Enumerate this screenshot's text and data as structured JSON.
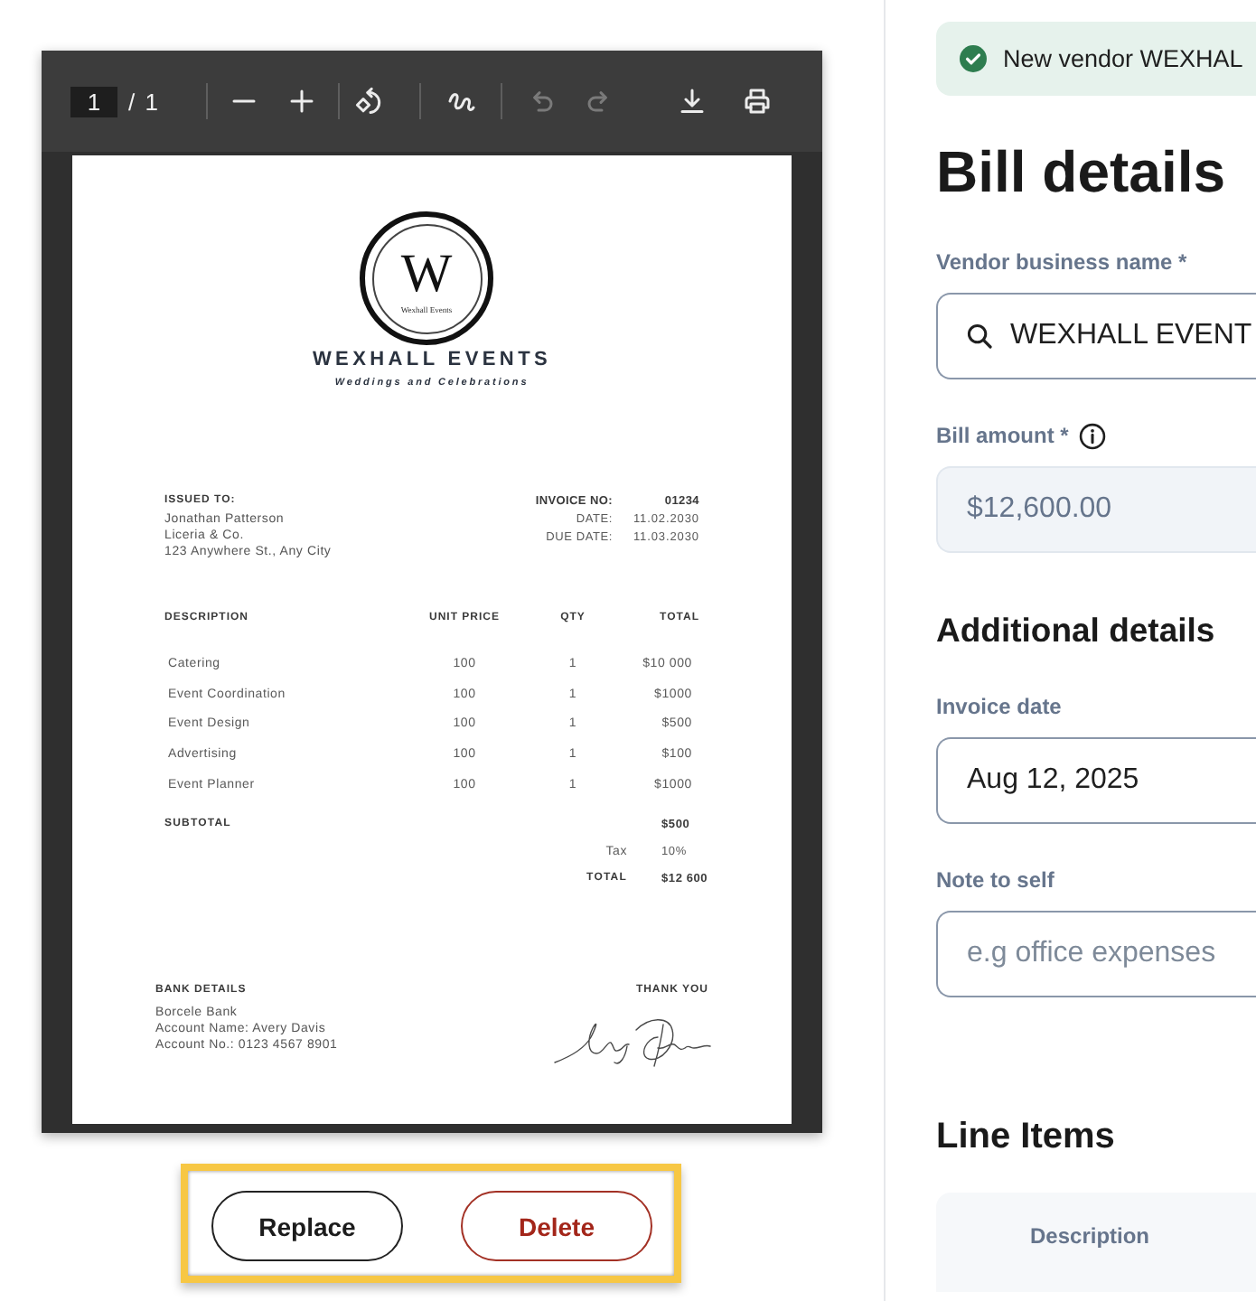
{
  "pdf_viewer": {
    "toolbar": {
      "page": "1",
      "page_count": "/ 1",
      "undo": {
        "disabled": true
      },
      "redo": {
        "disabled": true
      }
    },
    "invoice": {
      "logo": {
        "monogram": "W",
        "caption": "Wexhall Events"
      },
      "company": "WEXHALL EVENTS",
      "tagline": "Weddings and Celebrations",
      "issued_to": {
        "heading": "ISSUED TO:",
        "lines": [
          "Jonathan Patterson",
          "Liceria & Co.",
          "123 Anywhere St., Any City"
        ]
      },
      "meta": [
        {
          "label": "INVOICE NO:",
          "value": "01234",
          "emphasized": true
        },
        {
          "label": "DATE:",
          "value": "11.02.2030",
          "emphasized": false
        },
        {
          "label": "DUE DATE:",
          "value": "11.03.2030",
          "emphasized": false
        }
      ],
      "table": {
        "columns": [
          "DESCRIPTION",
          "UNIT PRICE",
          "QTY",
          "TOTAL"
        ],
        "rows": [
          [
            "Catering",
            "100",
            "1",
            "$10 000"
          ],
          [
            "Event Coordination",
            "100",
            "1",
            "$1000"
          ],
          [
            "Event Design",
            "100",
            "1",
            "$500"
          ],
          [
            "Advertising",
            "100",
            "1",
            "$100"
          ],
          [
            "Event Planner",
            "100",
            "1",
            "$1000"
          ]
        ]
      },
      "summary": [
        {
          "kind": "subtotal",
          "label": "SUBTOTAL",
          "value": "$500"
        },
        {
          "kind": "tax",
          "label": "Tax",
          "value": "10%"
        },
        {
          "kind": "total",
          "label": "TOTAL",
          "value": "$12 600"
        }
      ],
      "bank_details": {
        "heading": "BANK DETAILS",
        "lines": [
          "Borcele Bank",
          "Account Name: Avery Davis",
          "Account No.: 0123 4567 8901"
        ]
      },
      "closing": "THANK YOU"
    }
  },
  "file_actions": {
    "highlighted": true,
    "buttons": [
      {
        "kind": "secondary",
        "label": "Replace"
      },
      {
        "kind": "danger",
        "label": "Delete"
      }
    ]
  },
  "toast": {
    "kind": "success",
    "message": "New vendor WEXHAL"
  },
  "bill_details": {
    "title": "Bill details",
    "fields": [
      {
        "kind": "search",
        "label": "Vendor business name *",
        "info": false,
        "disabled": false,
        "value": "WEXHALL EVENT"
      },
      {
        "kind": "text",
        "label": "Bill amount *",
        "info": true,
        "disabled": true,
        "value": "$12,600.00"
      }
    ]
  },
  "additional_details": {
    "title": "Additional details",
    "fields": [
      {
        "kind": "text",
        "label": "Invoice date",
        "info": false,
        "disabled": false,
        "value": "Aug 12, 2025"
      },
      {
        "kind": "text",
        "label": "Note to self",
        "info": false,
        "disabled": false,
        "placeholder": "e.g office expenses"
      }
    ]
  },
  "line_items": {
    "title": "Line Items",
    "columns": [
      "Description"
    ]
  }
}
